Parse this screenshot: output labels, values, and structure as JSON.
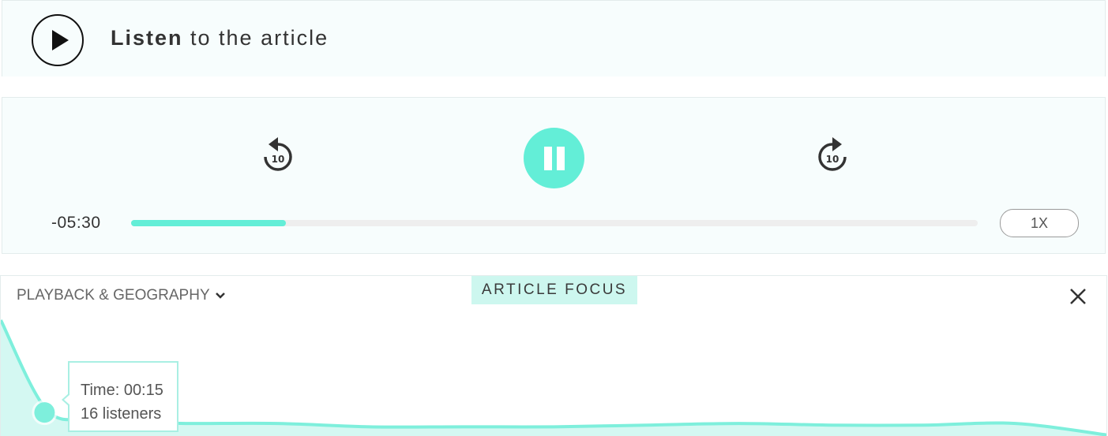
{
  "header": {
    "play_icon": "play-icon",
    "title_bold": "Listen",
    "title_rest": " to the article"
  },
  "player": {
    "rewind_label": "10",
    "forward_label": "10",
    "rewind_icon": "rewind-10-icon",
    "forward_icon": "forward-10-icon",
    "pause_icon": "pause-icon",
    "time_remaining": "-05:30",
    "progress_fraction": 0.183,
    "speed_label": "1X"
  },
  "insights": {
    "dropdown_label": "PLAYBACK & GEOGRAPHY",
    "dropdown_icon": "chevron-down-icon",
    "badge_label": "ARTICLE FOCUS",
    "close_icon": "close-icon",
    "tooltip": {
      "time_line": "Time: 00:15",
      "listeners_line": "16 listeners"
    }
  },
  "colors": {
    "accent": "#63eed7",
    "accent_light": "#cdf7ef",
    "panel_bg": "#f7fdfd"
  },
  "chart_data": {
    "type": "area",
    "x": [
      0,
      15,
      30,
      45,
      60,
      90,
      120,
      150,
      180,
      210,
      240,
      270,
      300,
      330,
      360
    ],
    "values": [
      70,
      16,
      11,
      9,
      8,
      8,
      6,
      6,
      6,
      7,
      8,
      7,
      7,
      8,
      1
    ],
    "xlabel": "",
    "ylabel": "",
    "highlight_index": 1
  }
}
